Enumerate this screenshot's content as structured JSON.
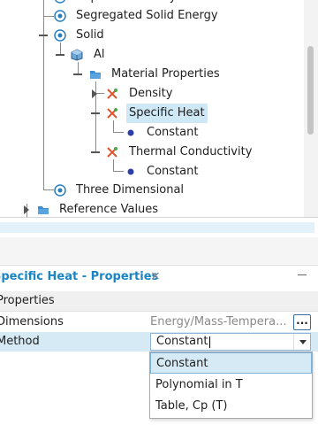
{
  "tree": {
    "items": [
      {
        "label": "Implicit Unsteady"
      },
      {
        "label": "Segregated Solid Energy"
      },
      {
        "label": "Solid"
      },
      {
        "label": "Al"
      },
      {
        "label": "Material Properties"
      },
      {
        "label": "Density"
      },
      {
        "label": "Specific Heat"
      },
      {
        "label": "Constant"
      },
      {
        "label": "Thermal Conductivity"
      },
      {
        "label": "Constant"
      },
      {
        "label": "Three Dimensional"
      },
      {
        "label": "Reference Values"
      }
    ]
  },
  "properties_panel": {
    "title": "Specific Heat - Properties",
    "close": "×",
    "header": "Properties",
    "rows": [
      {
        "key": "Dimensions",
        "value": "Energy/Mass-Tempera...",
        "button": "..."
      },
      {
        "key": "Method",
        "value": "Constant"
      }
    ]
  },
  "dropdown": {
    "options": [
      "Constant",
      "Polynomial in T",
      "Table, Cp (T)"
    ],
    "highlighted": "Constant"
  },
  "colors": {
    "accent": "#1a84c4",
    "selection": "#cfe8f6",
    "highlight": "#d6eaf5"
  }
}
